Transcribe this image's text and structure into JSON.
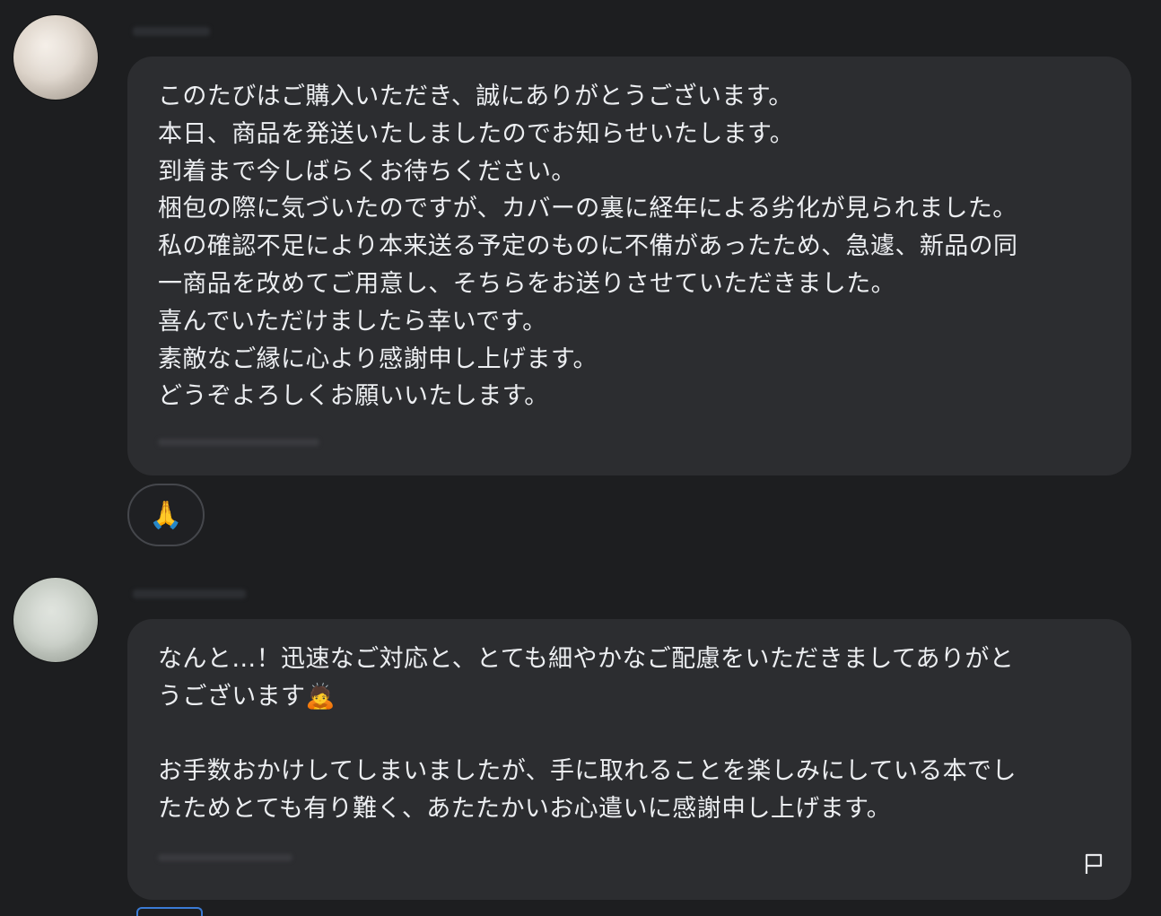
{
  "messages": [
    {
      "lines": [
        "このたびはご購入いただき、誠にありがとうございます。",
        "本日、商品を発送いたしましたのでお知らせいたします。",
        "到着まで今しばらくお待ちください。",
        "梱包の際に気づいたのですが、カバーの裏に経年による劣化が見られました。",
        "私の確認不足により本来送る予定のものに不備があったため、急遽、新品の同",
        "一商品を改めてご用意し、そちらをお送りさせていただきました。",
        "喜んでいただけましたら幸いです。",
        "素敵なご縁に心より感謝申し上げます。",
        "どうぞよろしくお願いいたします。"
      ],
      "reaction": "🙏"
    },
    {
      "lines": [
        "なんと…！迅速なご対応と、とても細やかなご配慮をいただきましてありがと",
        "うございます🙇",
        "",
        "お手数おかけしてしまいましたが、手に取れることを楽しみにしている本でし",
        "たためとても有り難く、あたたかいお心遣いに感謝申し上げます。"
      ],
      "action_icon": "flag-icon"
    }
  ],
  "colors": {
    "background": "#1d1e20",
    "bubble": "#2c2d30",
    "text": "#eceef1",
    "reaction_border": "#45474c"
  }
}
